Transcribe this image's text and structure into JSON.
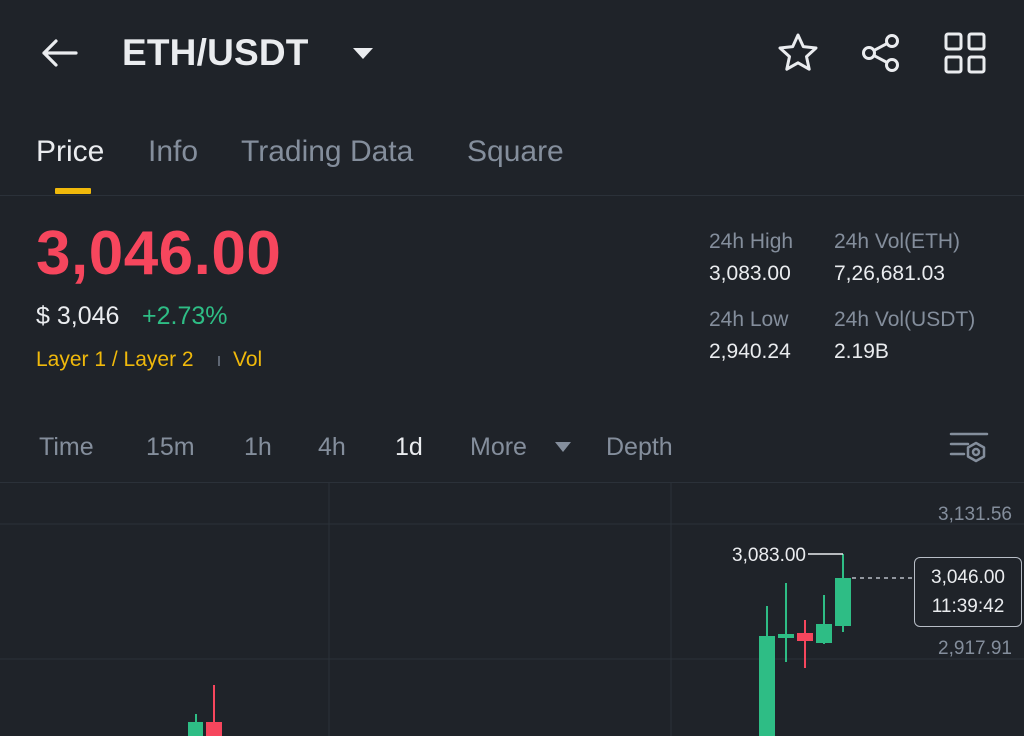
{
  "header": {
    "pair": "ETH/USDT",
    "icons": {
      "back": "arrow-left-icon",
      "pair_dropdown": "caret-down-icon",
      "favorite": "star-icon",
      "share": "share-icon",
      "more": "grid-icon"
    }
  },
  "tabs": [
    {
      "label": "Price",
      "active": true
    },
    {
      "label": "Info",
      "active": false
    },
    {
      "label": "Trading Data",
      "active": false
    },
    {
      "label": "Square",
      "active": false
    }
  ],
  "ticker": {
    "last_price": "3,046.00",
    "usd_price": "$ 3,046",
    "change_pct": "+2.73%",
    "tag": "Layer 1 / Layer 2",
    "tag_vol": "Vol",
    "stats": {
      "high_label": "24h High",
      "high_value": "3,083.00",
      "vol_eth_label": "24h Vol(ETH)",
      "vol_eth_value": "7,26,681.03",
      "low_label": "24h Low",
      "low_value": "2,940.24",
      "vol_usdt_label": "24h Vol(USDT)",
      "vol_usdt_value": "2.19B"
    }
  },
  "intervals": {
    "items": [
      "Time",
      "15m",
      "1h",
      "4h",
      "1d",
      "More",
      "Depth"
    ],
    "active": "1d",
    "settings_icon": "chart-settings-icon"
  },
  "chart": {
    "axis_top": "3,131.56",
    "axis_mid": "2,917.91",
    "high_marker": "3,083.00",
    "current_price": "3,046.00",
    "countdown": "11:39:42",
    "colors": {
      "up": "#2ebd85",
      "down": "#f6465d",
      "accent": "#f0b90b",
      "background": "#1f2329"
    }
  }
}
